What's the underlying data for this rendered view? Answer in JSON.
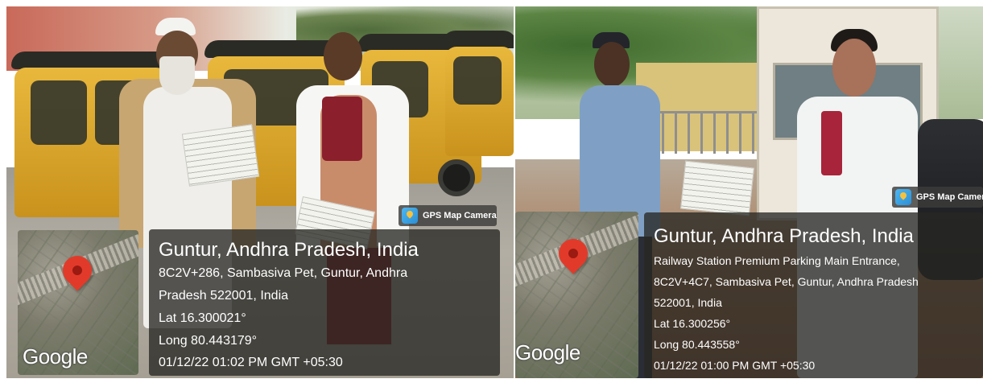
{
  "photos": [
    {
      "camera_label": "GPS Map Camera",
      "map_brand": "Google",
      "city": "Guntur, Andhra Pradesh, India",
      "address_lines": [
        "8C2V+286, Sambasiva Pet, Guntur, Andhra",
        "Pradesh 522001, India"
      ],
      "lat": "Lat 16.300021°",
      "long": "Long 80.443179°",
      "datetime": "01/12/22 01:02 PM GMT +05:30"
    },
    {
      "camera_label": "GPS Map Camera",
      "map_brand": "Google",
      "city": "Guntur, Andhra Pradesh, India",
      "address_lines": [
        "Railway Station Premium Parking Main Entrance,",
        "8C2V+4C7, Sambasiva Pet, Guntur, Andhra Pradesh",
        "522001, India"
      ],
      "lat": "Lat 16.300256°",
      "long": "Long 80.443558°",
      "datetime": "01/12/22 01:00 PM GMT +05:30"
    }
  ],
  "colors": {
    "pin": "#e23a2a",
    "overlay": "#282824",
    "auto_rickshaw": "#e8b83c"
  },
  "icons": [
    "map-pin-icon",
    "gps-camera-icon"
  ]
}
